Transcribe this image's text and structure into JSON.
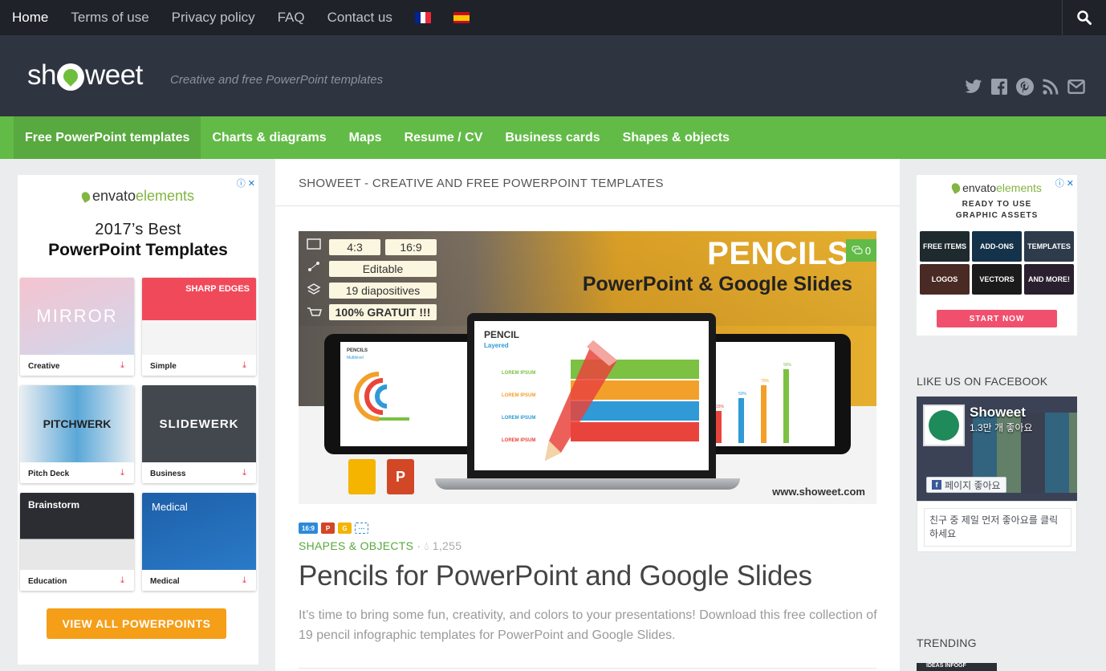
{
  "topbar": {
    "nav": [
      "Home",
      "Terms of use",
      "Privacy policy",
      "FAQ",
      "Contact us"
    ],
    "flags": [
      {
        "name": "french-flag",
        "colors": [
          "#002395",
          "#ffffff",
          "#ed2939"
        ]
      },
      {
        "name": "spanish-flag",
        "colors": [
          "#c60b1e",
          "#ffc400",
          "#c60b1e"
        ]
      }
    ],
    "search_icon": "search-icon"
  },
  "header": {
    "logo_prefix": "sh",
    "logo_suffix": "weet",
    "tagline": "Creative and free PowerPoint templates",
    "social_icons": [
      "twitter-icon",
      "facebook-icon",
      "pinterest-icon",
      "rss-icon",
      "email-icon"
    ]
  },
  "mainnav": {
    "items": [
      "Free PowerPoint templates",
      "Charts & diagrams",
      "Maps",
      "Resume / CV",
      "Business cards",
      "Shapes & objects"
    ]
  },
  "left_ad": {
    "brand_a": "envato",
    "brand_b": "elements",
    "heading_1": "2017’s Best",
    "heading_2": "PowerPoint Templates",
    "cards": [
      {
        "caption": "Creative",
        "thumb_text": "MIRROR",
        "bg": "#f4b7c7"
      },
      {
        "caption": "Simple",
        "thumb_text": "SHARP EDGES",
        "bg": "#f04a5a"
      },
      {
        "caption": "Pitch Deck",
        "thumb_text": "PITCHWERK",
        "bg": "#5aa8d8"
      },
      {
        "caption": "Business",
        "thumb_text": "SLIDEWERK",
        "bg": "#43484f"
      },
      {
        "caption": "Education",
        "thumb_text": "Brainstorm",
        "bg": "#2b2d33"
      },
      {
        "caption": "Medical",
        "thumb_text": "Medical",
        "bg": "#1d5fa8"
      }
    ],
    "cta": "VIEW ALL POWERPOINTS"
  },
  "main": {
    "section_title": "SHOWEET - CREATIVE AND FREE POWERPOINT TEMPLATES",
    "hero": {
      "tags": [
        "4:3",
        "16:9",
        "Editable",
        "19 diapositives",
        "100% GRATUIT !!!"
      ],
      "title_big": "PENCILS",
      "title_sub": "PowerPoint & Google Slides",
      "comments": "0",
      "screen_title": "PENCIL",
      "screen_subtitle": "Layered",
      "screen_lines": [
        "LOREM IPSUM",
        "LOREM IPSUM",
        "LOREM IPSUM",
        "LOREM IPSUM"
      ],
      "left_tablet_title": "PENCILS",
      "left_tablet_sub": "Multilevel",
      "right_tablet_values": [
        "15%",
        "50%",
        "70%",
        "90%"
      ],
      "watermark": "www.showeet.com",
      "band_colors": [
        "#7cc142",
        "#f2a02a",
        "#2f9ad6",
        "#e9443c"
      ]
    },
    "badges": [
      {
        "name": "ratio-16-9-badge",
        "text": "16:9",
        "color": "#2d8ad8"
      },
      {
        "name": "powerpoint-badge",
        "text": "P",
        "color": "#d24726"
      },
      {
        "name": "google-slides-badge",
        "text": "G",
        "color": "#f4b400"
      },
      {
        "name": "editable-badge",
        "text": "⋯",
        "color": "#ffffff"
      }
    ],
    "category": "SHAPES & OBJECTS",
    "separator": "·",
    "views": "1,255",
    "post_title": "Pencils for PowerPoint and Google Slides",
    "excerpt": "It’s time to bring some fun, creativity, and colors to your presentations! Download this free collection of 19 pencil infographic templates for PowerPoint and Google Slides."
  },
  "right_ad": {
    "brand_a": "envato",
    "brand_b": "elements",
    "ready_1": "READY TO USE",
    "ready_2": "GRAPHIC ASSETS",
    "tiles": [
      {
        "label": "FREE ITEMS",
        "bg": "#1e2a2e"
      },
      {
        "label": "ADD-ONS",
        "bg": "#14324a"
      },
      {
        "label": "TEMPLATES",
        "bg": "#2d3b4b"
      },
      {
        "label": "LOGOS",
        "bg": "#4a2a24"
      },
      {
        "label": "VECTORS",
        "bg": "#1b1b1b"
      },
      {
        "label": "AND MORE!",
        "bg": "#2a1f2e"
      }
    ],
    "cta": "START NOW"
  },
  "sidebar": {
    "facebook_heading": "LIKE US ON FACEBOOK",
    "fb_page_name": "Showeet",
    "fb_likes": "1.3만 개 좋아요",
    "fb_like_button": "페이지 좋아요",
    "fb_footer": "친구 중 제일 먼저 좋아요를 클릭하세요",
    "trending_heading": "TRENDING",
    "trending_thumb": "IDEAS INFOGF"
  },
  "colors": {
    "accent_green": "#62bb47",
    "topbar": "#1f2229",
    "header": "#2e3440",
    "cta_orange": "#f59e18",
    "cta_pink": "#f0506e"
  }
}
